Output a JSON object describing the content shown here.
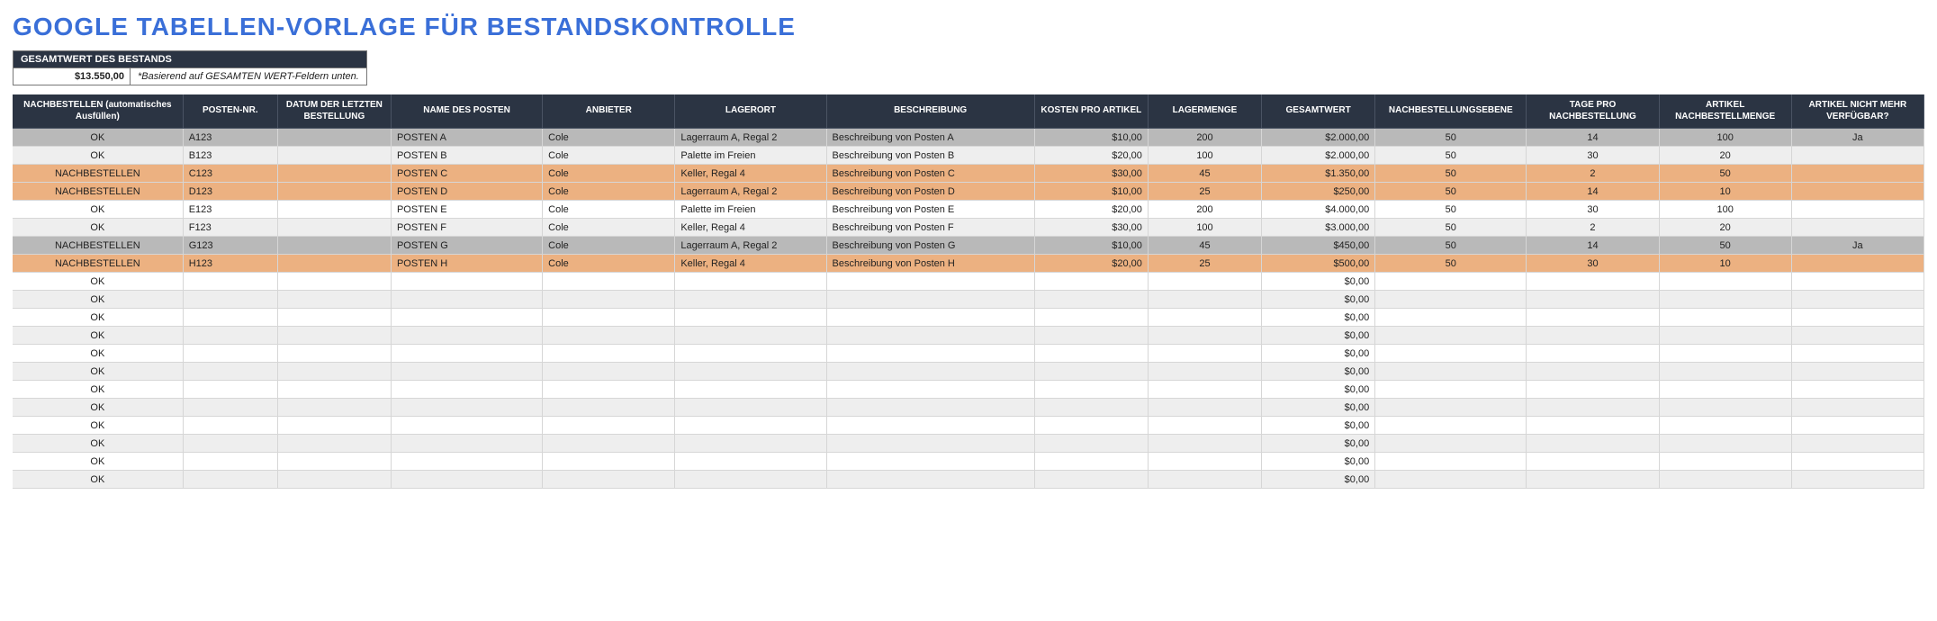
{
  "title": "GOOGLE TABELLEN-VORLAGE FÜR BESTANDSKONTROLLE",
  "summary": {
    "header": "GESAMTWERT DES BESTANDS",
    "value": "$13.550,00",
    "note": "*Basierend auf GESAMTEN WERT-Feldern unten."
  },
  "columns": [
    "NACHBESTELLEN (automatisches Ausfüllen)",
    "POSTEN-NR.",
    "DATUM DER LETZTEN BESTELLUNG",
    "NAME DES POSTEN",
    "ANBIETER",
    "LAGERORT",
    "BESCHREIBUNG",
    "KOSTEN PRO ARTIKEL",
    "LAGERMENGE",
    "GESAMTWERT",
    "NACHBESTELLUNGSEBENE",
    "TAGE PRO NACHBESTELLUNG",
    "ARTIKEL NACHBESTELLMENGE",
    "ARTIKEL NICHT MEHR VERFÜGBAR?"
  ],
  "rows": [
    {
      "style": "row-grey",
      "reorder": "OK",
      "item_no": "A123",
      "last_order": "",
      "name": "POSTEN A",
      "vendor": "Cole",
      "location": "Lagerraum A, Regal 2",
      "desc": "Beschreibung von Posten A",
      "cost": "$10,00",
      "stock": "200",
      "total": "$2.000,00",
      "level": "50",
      "days": "14",
      "qty": "100",
      "disc": "Ja"
    },
    {
      "style": "row-lite",
      "reorder": "OK",
      "item_no": "B123",
      "last_order": "",
      "name": "POSTEN B",
      "vendor": "Cole",
      "location": "Palette im Freien",
      "desc": "Beschreibung von Posten B",
      "cost": "$20,00",
      "stock": "100",
      "total": "$2.000,00",
      "level": "50",
      "days": "30",
      "qty": "20",
      "disc": ""
    },
    {
      "style": "row-orng",
      "reorder": "NACHBESTELLEN",
      "item_no": "C123",
      "last_order": "",
      "name": "POSTEN C",
      "vendor": "Cole",
      "location": "Keller, Regal 4",
      "desc": "Beschreibung von Posten C",
      "cost": "$30,00",
      "stock": "45",
      "total": "$1.350,00",
      "level": "50",
      "days": "2",
      "qty": "50",
      "disc": ""
    },
    {
      "style": "row-orng",
      "reorder": "NACHBESTELLEN",
      "item_no": "D123",
      "last_order": "",
      "name": "POSTEN D",
      "vendor": "Cole",
      "location": "Lagerraum A, Regal 2",
      "desc": "Beschreibung von Posten D",
      "cost": "$10,00",
      "stock": "25",
      "total": "$250,00",
      "level": "50",
      "days": "14",
      "qty": "10",
      "disc": ""
    },
    {
      "style": "row-white",
      "reorder": "OK",
      "item_no": "E123",
      "last_order": "",
      "name": "POSTEN E",
      "vendor": "Cole",
      "location": "Palette im Freien",
      "desc": "Beschreibung von Posten E",
      "cost": "$20,00",
      "stock": "200",
      "total": "$4.000,00",
      "level": "50",
      "days": "30",
      "qty": "100",
      "disc": ""
    },
    {
      "style": "row-lite",
      "reorder": "OK",
      "item_no": "F123",
      "last_order": "",
      "name": "POSTEN F",
      "vendor": "Cole",
      "location": "Keller, Regal 4",
      "desc": "Beschreibung von Posten F",
      "cost": "$30,00",
      "stock": "100",
      "total": "$3.000,00",
      "level": "50",
      "days": "2",
      "qty": "20",
      "disc": ""
    },
    {
      "style": "row-grey",
      "reorder": "NACHBESTELLEN",
      "item_no": "G123",
      "last_order": "",
      "name": "POSTEN G",
      "vendor": "Cole",
      "location": "Lagerraum A, Regal 2",
      "desc": "Beschreibung von Posten G",
      "cost": "$10,00",
      "stock": "45",
      "total": "$450,00",
      "level": "50",
      "days": "14",
      "qty": "50",
      "disc": "Ja"
    },
    {
      "style": "row-orng",
      "reorder": "NACHBESTELLEN",
      "item_no": "H123",
      "last_order": "",
      "name": "POSTEN H",
      "vendor": "Cole",
      "location": "Keller, Regal 4",
      "desc": "Beschreibung von Posten H",
      "cost": "$20,00",
      "stock": "25",
      "total": "$500,00",
      "level": "50",
      "days": "30",
      "qty": "10",
      "disc": ""
    },
    {
      "style": "row-white",
      "reorder": "OK",
      "item_no": "",
      "last_order": "",
      "name": "",
      "vendor": "",
      "location": "",
      "desc": "",
      "cost": "",
      "stock": "",
      "total": "$0,00",
      "level": "",
      "days": "",
      "qty": "",
      "disc": ""
    },
    {
      "style": "row-lite",
      "reorder": "OK",
      "item_no": "",
      "last_order": "",
      "name": "",
      "vendor": "",
      "location": "",
      "desc": "",
      "cost": "",
      "stock": "",
      "total": "$0,00",
      "level": "",
      "days": "",
      "qty": "",
      "disc": ""
    },
    {
      "style": "row-white",
      "reorder": "OK",
      "item_no": "",
      "last_order": "",
      "name": "",
      "vendor": "",
      "location": "",
      "desc": "",
      "cost": "",
      "stock": "",
      "total": "$0,00",
      "level": "",
      "days": "",
      "qty": "",
      "disc": ""
    },
    {
      "style": "row-lite",
      "reorder": "OK",
      "item_no": "",
      "last_order": "",
      "name": "",
      "vendor": "",
      "location": "",
      "desc": "",
      "cost": "",
      "stock": "",
      "total": "$0,00",
      "level": "",
      "days": "",
      "qty": "",
      "disc": ""
    },
    {
      "style": "row-white",
      "reorder": "OK",
      "item_no": "",
      "last_order": "",
      "name": "",
      "vendor": "",
      "location": "",
      "desc": "",
      "cost": "",
      "stock": "",
      "total": "$0,00",
      "level": "",
      "days": "",
      "qty": "",
      "disc": ""
    },
    {
      "style": "row-lite",
      "reorder": "OK",
      "item_no": "",
      "last_order": "",
      "name": "",
      "vendor": "",
      "location": "",
      "desc": "",
      "cost": "",
      "stock": "",
      "total": "$0,00",
      "level": "",
      "days": "",
      "qty": "",
      "disc": ""
    },
    {
      "style": "row-white",
      "reorder": "OK",
      "item_no": "",
      "last_order": "",
      "name": "",
      "vendor": "",
      "location": "",
      "desc": "",
      "cost": "",
      "stock": "",
      "total": "$0,00",
      "level": "",
      "days": "",
      "qty": "",
      "disc": ""
    },
    {
      "style": "row-lite",
      "reorder": "OK",
      "item_no": "",
      "last_order": "",
      "name": "",
      "vendor": "",
      "location": "",
      "desc": "",
      "cost": "",
      "stock": "",
      "total": "$0,00",
      "level": "",
      "days": "",
      "qty": "",
      "disc": ""
    },
    {
      "style": "row-white",
      "reorder": "OK",
      "item_no": "",
      "last_order": "",
      "name": "",
      "vendor": "",
      "location": "",
      "desc": "",
      "cost": "",
      "stock": "",
      "total": "$0,00",
      "level": "",
      "days": "",
      "qty": "",
      "disc": ""
    },
    {
      "style": "row-lite",
      "reorder": "OK",
      "item_no": "",
      "last_order": "",
      "name": "",
      "vendor": "",
      "location": "",
      "desc": "",
      "cost": "",
      "stock": "",
      "total": "$0,00",
      "level": "",
      "days": "",
      "qty": "",
      "disc": ""
    },
    {
      "style": "row-white",
      "reorder": "OK",
      "item_no": "",
      "last_order": "",
      "name": "",
      "vendor": "",
      "location": "",
      "desc": "",
      "cost": "",
      "stock": "",
      "total": "$0,00",
      "level": "",
      "days": "",
      "qty": "",
      "disc": ""
    },
    {
      "style": "row-lite",
      "reorder": "OK",
      "item_no": "",
      "last_order": "",
      "name": "",
      "vendor": "",
      "location": "",
      "desc": "",
      "cost": "",
      "stock": "",
      "total": "$0,00",
      "level": "",
      "days": "",
      "qty": "",
      "disc": ""
    }
  ]
}
